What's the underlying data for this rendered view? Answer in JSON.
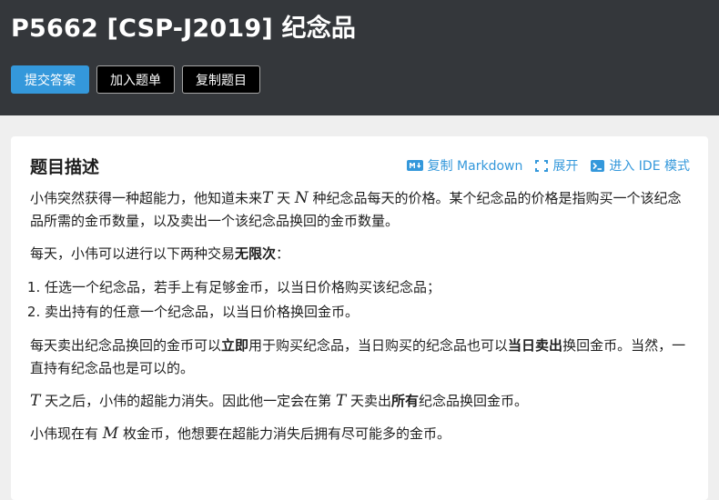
{
  "header": {
    "title": "P5662 [CSP-J2019] 纪念品",
    "buttons": {
      "submit": "提交答案",
      "add_to_list": "加入题单",
      "copy_problem": "复制题目"
    }
  },
  "card": {
    "title": "题目描述",
    "actions": {
      "copy_markdown": "复制 Markdown",
      "expand": "展开",
      "enter_ide": "进入 IDE 模式"
    }
  },
  "content": {
    "p1": {
      "a": "小伟突然获得一种超能力，他知道未来",
      "m1": "T",
      "b": " 天 ",
      "m2": "N",
      "c": " 种纪念品每天的价格。某个纪念品的价格是指购买一个该纪念品所需的金币数量，以及卖出一个该纪念品换回的金币数量。"
    },
    "p2": {
      "a": "每天，小伟可以进行以下两种交易",
      "bold": "无限次",
      "c": "："
    },
    "list": [
      "任选一个纪念品，若手上有足够金币，以当日价格购买该纪念品；",
      "卖出持有的任意一个纪念品，以当日价格换回金币。"
    ],
    "p3": {
      "a": "每天卖出纪念品换回的金币可以",
      "bold1": "立即",
      "b": "用于购买纪念品，当日购买的纪念品也可以",
      "bold2": "当日卖出",
      "c": "换回金币。当然，一直持有纪念品也是可以的。"
    },
    "p4": {
      "m1": "T",
      "a": " 天之后，小伟的超能力消失。因此他一定会在第 ",
      "m2": "T",
      "b": " 天卖出",
      "bold": "所有",
      "c": "纪念品换回金币。"
    },
    "p5": {
      "a": "小伟现在有 ",
      "m": "M",
      "b": " 枚金币，他想要在超能力消失后拥有尽可能多的金币。"
    }
  },
  "colors": {
    "header_bg": "#34373b",
    "primary": "#3498db",
    "page_bg": "#efefef"
  },
  "icons": {
    "markdown": "markdown-icon",
    "expand": "expand-icon",
    "ide": "terminal-icon"
  }
}
